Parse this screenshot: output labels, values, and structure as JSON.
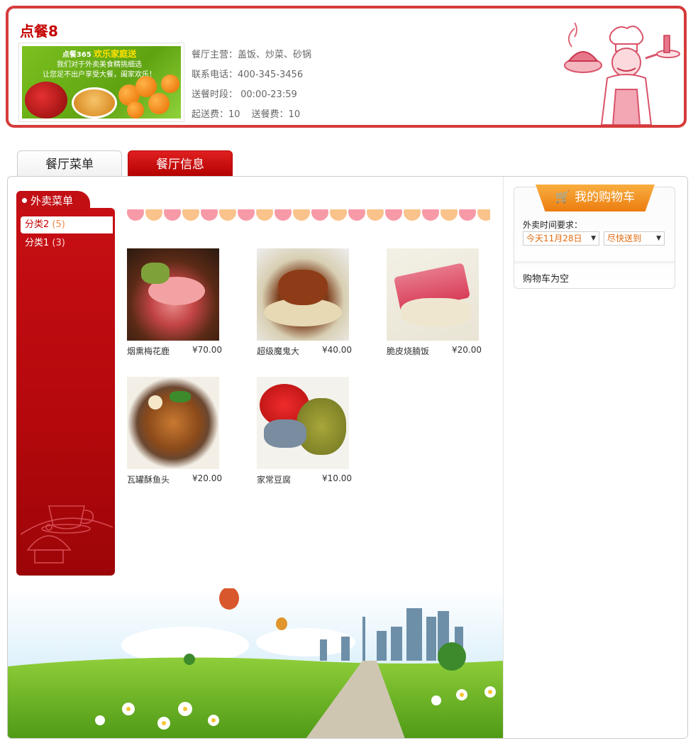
{
  "header": {
    "shop_name": "点餐8",
    "banner": {
      "line1_prefix": "点餐365",
      "line1_highlight": "欢乐家庭送",
      "line2": "我们对于外卖美食精挑细选",
      "line3": "让您足不出户享受大餐，阖家欢乐！"
    },
    "info": {
      "main_business": "餐厅主营：盖饭、炒菜、砂锅",
      "phone": "联系电话：400-345-3456",
      "delivery_time": "送餐时段： 00:00-23:59",
      "min_order": "起送费：10",
      "delivery_fee": "送餐费：10"
    }
  },
  "tabs": [
    {
      "label": "餐厅菜单"
    },
    {
      "label": "餐厅信息"
    }
  ],
  "sidebar": {
    "title": "外卖菜单",
    "categories": [
      {
        "label": "分类2",
        "count": "(5)"
      },
      {
        "label": "分类1",
        "count": "(3)"
      }
    ]
  },
  "dishes": [
    {
      "name": "烟熏梅花鹿",
      "price": "¥70.00"
    },
    {
      "name": "超级魔鬼大",
      "price": "¥40.00"
    },
    {
      "name": "脆皮烧腩饭",
      "price": "¥20.00"
    },
    {
      "name": "瓦罐酥鱼头",
      "price": "¥20.00"
    },
    {
      "name": "家常豆腐",
      "price": "¥10.00"
    }
  ],
  "cart": {
    "title": "我的购物车",
    "time_label": "外卖时间要求：",
    "day_select": "今天11月28日",
    "time_select": "尽快送到",
    "empty_text": "购物车为空"
  },
  "colors": {
    "brand_red": "#c40000",
    "cart_orange": "#ec7d10",
    "border_red": "#d63b3b"
  }
}
